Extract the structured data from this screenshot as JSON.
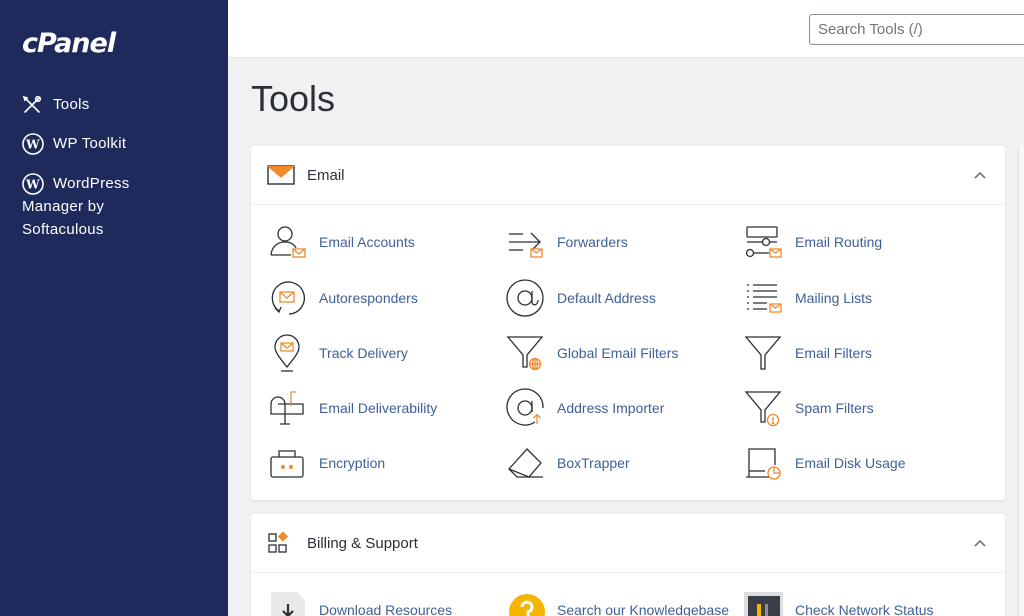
{
  "sidebar": {
    "logo": "cPanel",
    "items": [
      {
        "label": "Tools",
        "icon": "tools-icon"
      },
      {
        "label": "WP Toolkit",
        "icon": "wordpress-icon"
      },
      {
        "label_lines": [
          "WordPress",
          "Manager by",
          "Softaculous"
        ],
        "icon": "wordpress-icon"
      }
    ]
  },
  "search": {
    "placeholder": "Search Tools (/)"
  },
  "page": {
    "title": "Tools"
  },
  "sections": [
    {
      "title": "Email",
      "icon": "envelope-icon",
      "tools": [
        {
          "label": "Email Accounts",
          "icon": "user-mail-icon"
        },
        {
          "label": "Forwarders",
          "icon": "forward-arrow-icon"
        },
        {
          "label": "Email Routing",
          "icon": "routing-icon"
        },
        {
          "label": "Autoresponders",
          "icon": "autoresponder-icon"
        },
        {
          "label": "Default Address",
          "icon": "at-sign-icon"
        },
        {
          "label": "Mailing Lists",
          "icon": "mailing-list-icon"
        },
        {
          "label": "Track Delivery",
          "icon": "location-pin-icon"
        },
        {
          "label": "Global Email Filters",
          "icon": "funnel-globe-icon"
        },
        {
          "label": "Email Filters",
          "icon": "funnel-icon"
        },
        {
          "label": "Email Deliverability",
          "icon": "mailbox-icon"
        },
        {
          "label": "Address Importer",
          "icon": "at-import-icon"
        },
        {
          "label": "Spam Filters",
          "icon": "funnel-alert-icon"
        },
        {
          "label": "Encryption",
          "icon": "lock-box-icon"
        },
        {
          "label": "BoxTrapper",
          "icon": "boxtrapper-icon"
        },
        {
          "label": "Email Disk Usage",
          "icon": "disk-usage-icon"
        }
      ]
    },
    {
      "title": "Billing & Support",
      "icon": "grid-shapes-icon",
      "tools": [
        {
          "label": "Download Resources",
          "icon": "download-icon"
        },
        {
          "label": "Search our Knowledgebase",
          "icon": "knowledgebase-icon"
        },
        {
          "label": "Check Network Status",
          "icon": "network-status-icon"
        }
      ]
    }
  ],
  "colors": {
    "sidebar_bg": "#1f2a5c",
    "link": "#3f5f99",
    "accent_orange": "#f08a2c",
    "kb_yellow": "#f5b400"
  }
}
